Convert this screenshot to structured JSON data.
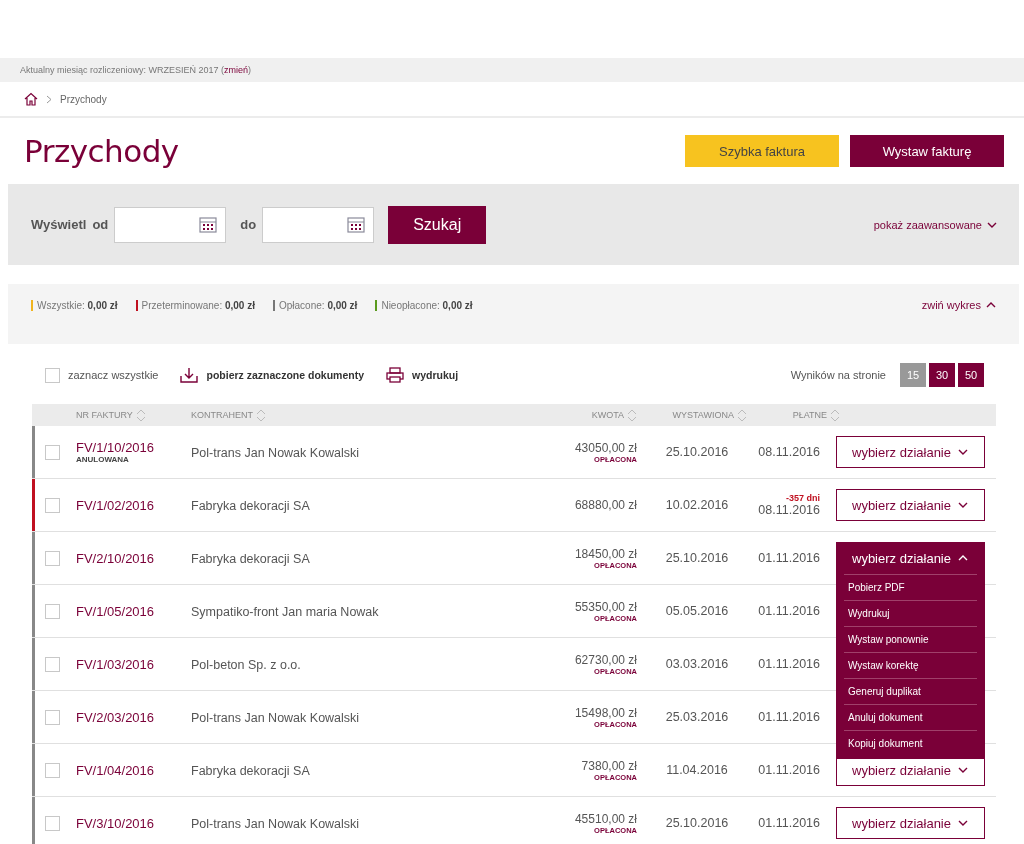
{
  "billing_bar": {
    "text": "Aktualny miesiąc rozliczeniowy: WRZESIEŃ 2017 (",
    "link": "zmień",
    "suffix": ")"
  },
  "breadcrumb": {
    "current": "Przychody"
  },
  "page_title": "Przychody",
  "header_buttons": [
    {
      "label": "Szybka faktura",
      "kind": "secondary"
    },
    {
      "label": "Wystaw fakturę",
      "kind": "primary"
    }
  ],
  "filter": {
    "label": "Wyświetl",
    "from_label": "od",
    "to_label": "do",
    "search_button": "Szukaj",
    "advanced_link": "pokaż zaawansowane"
  },
  "summary": {
    "items": [
      {
        "label": "Wszystkie:",
        "value": "0,00 zł",
        "color": "#f0b41e"
      },
      {
        "label": "Przeterminowane:",
        "value": "0,00 zł",
        "color": "#c01020"
      },
      {
        "label": "Opłacone:",
        "value": "0,00 zł",
        "color": "#777777"
      },
      {
        "label": "Nieopłacone:",
        "value": "0,00 zł",
        "color": "#5a9a1e"
      }
    ],
    "collapse_link": "zwiń wykres"
  },
  "toolbar": {
    "select_all": {
      "label": "zaznacz wszystkie",
      "checked": false
    },
    "download": "pobierz zaznaczone dokumenty",
    "print": "wydrukuj",
    "page_size_label": "Wyników na stronie",
    "page_sizes": [
      {
        "label": "15",
        "selected": true
      },
      {
        "label": "30",
        "selected": false
      },
      {
        "label": "50",
        "selected": false
      }
    ]
  },
  "table": {
    "columns": [
      "NR FAKTURY",
      "KONTRAHENT",
      "KWOTA",
      "WYSTAWIONA",
      "PŁATNE"
    ],
    "rows": [
      {
        "number": "FV/1/10/2016",
        "number_status": "ANULOWANA",
        "contractor": "Pol-trans Jan Nowak Kowalski",
        "amount": "43050,00 zł",
        "amount_status": "OPŁACONA",
        "issued": "25.10.2016",
        "due": "08.11.2016",
        "color": "#888888",
        "checked": false,
        "action": "wybierz działanie",
        "expanded": false
      },
      {
        "number": "FV/1/02/2016",
        "contractor": "Fabryka dekoracji SA",
        "amount": "68880,00 zł",
        "issued": "10.02.2016",
        "overdue": "-357 dni",
        "due": "08.11.2016",
        "color": "#c01020",
        "checked": false,
        "action": "wybierz działanie",
        "expanded": false
      },
      {
        "number": "FV/2/10/2016",
        "contractor": "Fabryka dekoracji SA",
        "amount": "18450,00 zł",
        "amount_status": "OPŁACONA",
        "issued": "25.10.2016",
        "due": "01.11.2016",
        "color": "#888888",
        "checked": false,
        "action": "wybierz działanie",
        "expanded": true,
        "menu": [
          "Pobierz PDF",
          "Wydrukuj",
          "Wystaw ponownie",
          "Wystaw korektę",
          "Generuj duplikat",
          "Anuluj dokument",
          "Kopiuj dokument"
        ]
      },
      {
        "number": "FV/1/05/2016",
        "contractor": "Sympatiko-front Jan maria Nowak",
        "amount": "55350,00 zł",
        "amount_status": "OPŁACONA",
        "issued": "05.05.2016",
        "due": "01.11.2016",
        "color": "#888888",
        "checked": false
      },
      {
        "number": "FV/1/03/2016",
        "contractor": "Pol-beton Sp. z o.o.",
        "amount": "62730,00 zł",
        "amount_status": "OPŁACONA",
        "issued": "03.03.2016",
        "due": "01.11.2016",
        "color": "#888888",
        "checked": false
      },
      {
        "number": "FV/2/03/2016",
        "contractor": "Pol-trans Jan Nowak Kowalski",
        "amount": "15498,00 zł",
        "amount_status": "OPŁACONA",
        "issued": "25.03.2016",
        "due": "01.11.2016",
        "color": "#888888",
        "checked": false
      },
      {
        "number": "FV/1/04/2016",
        "contractor": "Fabryka dekoracji SA",
        "amount": "7380,00 zł",
        "amount_status": "OPŁACONA",
        "issued": "11.04.2016",
        "due": "01.11.2016",
        "color": "#888888",
        "checked": false,
        "action": "wybierz działanie",
        "expanded": false
      },
      {
        "number": "FV/3/10/2016",
        "contractor": "Pol-trans Jan Nowak Kowalski",
        "amount": "45510,00 zł",
        "amount_status": "OPŁACONA",
        "issued": "25.10.2016",
        "due": "01.11.2016",
        "color": "#888888",
        "checked": false,
        "action": "wybierz działanie",
        "expanded": false
      }
    ]
  }
}
